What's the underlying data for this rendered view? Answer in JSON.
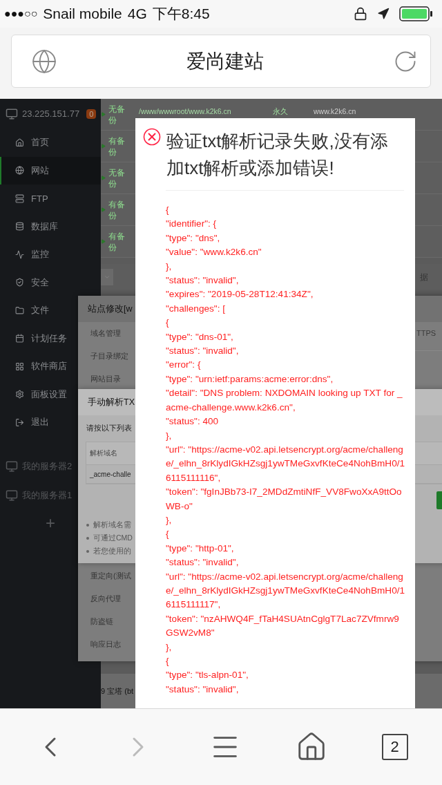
{
  "status_bar": {
    "signal": "●●●○○",
    "carrier": "Snail mobile",
    "network": "4G",
    "time": "下午8:45"
  },
  "browser": {
    "title": "爱尚建站"
  },
  "sidebar": {
    "server": "23.225.151.77",
    "badge": "0",
    "items": [
      {
        "label": "首页",
        "selected": false
      },
      {
        "label": "网站",
        "selected": true
      },
      {
        "label": "FTP",
        "selected": false
      },
      {
        "label": "数据库",
        "selected": false
      },
      {
        "label": "监控",
        "selected": false
      },
      {
        "label": "安全",
        "selected": false
      },
      {
        "label": "文件",
        "selected": false
      },
      {
        "label": "计划任务",
        "selected": false
      },
      {
        "label": "软件商店",
        "selected": false
      },
      {
        "label": "面板设置",
        "selected": false
      },
      {
        "label": "退出",
        "selected": false
      }
    ],
    "servers": [
      "我的服务器2",
      "我的服务器1"
    ],
    "add": "+"
  },
  "site_table": {
    "rows": [
      {
        "backup": "无备份",
        "path": "/www/wwwroot/www.k2k6.cn",
        "expiry": "永久",
        "remark": "www.k2k6.cn"
      },
      {
        "backup": "有备份"
      },
      {
        "backup": "无备份"
      },
      {
        "backup": "有备份"
      },
      {
        "backup": "有备份"
      }
    ]
  },
  "pager_text": "据",
  "site_dialog": {
    "title": "站点修改[w",
    "menu_top": [
      "域名管理",
      "子目录绑定",
      "网站目录"
    ],
    "tab": "TTPS",
    "menu_bottom": [
      "重定向(测试",
      "反向代理",
      "防盗链",
      "响应日志"
    ]
  },
  "txt_dialog": {
    "title": "手动解析TX",
    "intro": "请按以下列表",
    "table_header": "解析域名",
    "table_row": "_acme-challe",
    "notes": [
      "解析域名需",
      "可通过CMD",
      "若您使用的"
    ]
  },
  "footer": "9 宝塔 (bt",
  "error_dialog": {
    "title": "验证txt解析记录失败,没有添加txt解析或添加错误!",
    "response_lines": [
      "{",
      "\"identifier\": {",
      "\"type\": \"dns\",",
      "\"value\": \"www.k2k6.cn\"",
      "},",
      "\"status\": \"invalid\",",
      "\"expires\": \"2019-05-28T12:41:34Z\",",
      "\"challenges\": [",
      "{",
      "\"type\": \"dns-01\",",
      "\"status\": \"invalid\",",
      "\"error\": {",
      "\"type\": \"urn:ietf:params:acme:error:dns\",",
      "\"detail\": \"DNS problem: NXDOMAIN looking up TXT for _acme-challenge.www.k2k6.cn\",",
      "\"status\": 400",
      "},",
      "\"url\": \"https://acme-v02.api.letsencrypt.org/acme/challenge/_elhn_8rKlydIGkHZsgj1ywTMeGxvfKteCe4NohBmH0/16115111116\",",
      "\"token\": \"fgInJBb73-I7_2MDdZmtiNfF_VV8FwoXxA9ttOoWB-o\"",
      "},",
      "{",
      "\"type\": \"http-01\",",
      "\"status\": \"invalid\",",
      "\"url\": \"https://acme-v02.api.letsencrypt.org/acme/challenge/_elhn_8rKlydIGkHZsgj1ywTMeGxvfKteCe4NohBmH0/16115111117\",",
      "\"token\": \"nzAHWQ4F_fTaH4SUAtnCglgT7Lac7ZVfmrw9GSW2vM8\"",
      "},",
      "{",
      "\"type\": \"tls-alpn-01\",",
      "\"status\": \"invalid\","
    ]
  },
  "toolbar": {
    "back": {
      "disabled": false
    },
    "forward": {
      "disabled": true
    },
    "tabs": "2"
  }
}
